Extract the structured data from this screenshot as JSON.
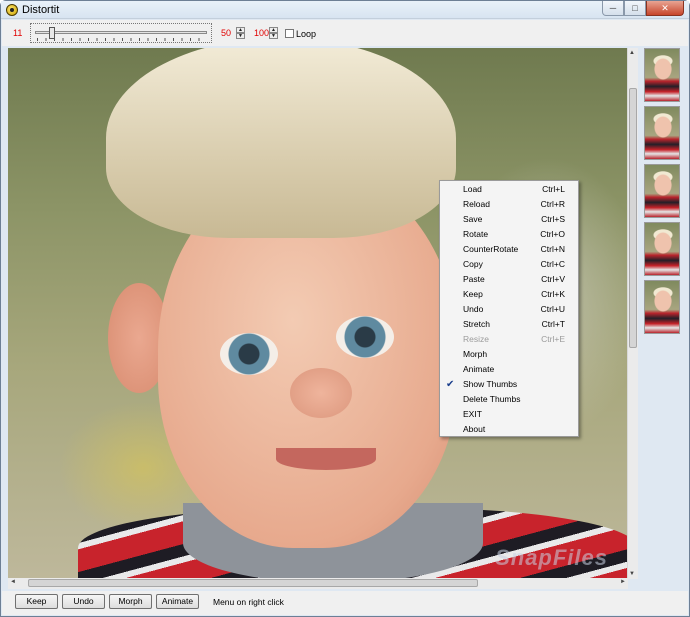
{
  "window": {
    "title": "Distortit",
    "controls": {
      "minimize": "─",
      "maximize": "□",
      "close": "✕"
    }
  },
  "toolbar": {
    "slider_value": "11",
    "slider_level_fraction": 0.08,
    "field1_value": "50",
    "field2_value": "100",
    "loop_label": "Loop",
    "loop_checked": false
  },
  "icons": [
    "app-icon",
    "spin-up-icon",
    "spin-down-icon",
    "checkmark-icon",
    "scroll-arrow-icons"
  ],
  "colors": {
    "value_red": "#e00000",
    "window_frame": "#dfe8f2",
    "menu_bg": "#f4f4f4"
  },
  "context_menu": {
    "items": [
      {
        "label": "Load",
        "shortcut": "Ctrl+L",
        "enabled": true,
        "checked": false
      },
      {
        "label": "Reload",
        "shortcut": "Ctrl+R",
        "enabled": true,
        "checked": false
      },
      {
        "label": "Save",
        "shortcut": "Ctrl+S",
        "enabled": true,
        "checked": false
      },
      {
        "label": "Rotate",
        "shortcut": "Ctrl+O",
        "enabled": true,
        "checked": false
      },
      {
        "label": "CounterRotate",
        "shortcut": "Ctrl+N",
        "enabled": true,
        "checked": false
      },
      {
        "label": "Copy",
        "shortcut": "Ctrl+C",
        "enabled": true,
        "checked": false
      },
      {
        "label": "Paste",
        "shortcut": "Ctrl+V",
        "enabled": true,
        "checked": false
      },
      {
        "label": "Keep",
        "shortcut": "Ctrl+K",
        "enabled": true,
        "checked": false
      },
      {
        "label": "Undo",
        "shortcut": "Ctrl+U",
        "enabled": true,
        "checked": false
      },
      {
        "label": "Stretch",
        "shortcut": "Ctrl+T",
        "enabled": true,
        "checked": false
      },
      {
        "label": "Resize",
        "shortcut": "Ctrl+E",
        "enabled": false,
        "checked": false
      },
      {
        "label": "Morph",
        "shortcut": "",
        "enabled": true,
        "checked": false
      },
      {
        "label": "Animate",
        "shortcut": "",
        "enabled": true,
        "checked": false
      },
      {
        "label": "Show Thumbs",
        "shortcut": "",
        "enabled": true,
        "checked": true
      },
      {
        "label": "Delete Thumbs",
        "shortcut": "",
        "enabled": true,
        "checked": false
      },
      {
        "label": "EXIT",
        "shortcut": "",
        "enabled": true,
        "checked": false
      },
      {
        "label": "About",
        "shortcut": "",
        "enabled": true,
        "checked": false
      }
    ]
  },
  "bottom_bar": {
    "keep_label": "Keep",
    "undo_label": "Undo",
    "morph_label": "Morph",
    "animate_label": "Animate",
    "status_text": "Menu on right click"
  },
  "canvas": {
    "watermark": "SnapFiles"
  },
  "thumbnails": {
    "count": 5
  }
}
